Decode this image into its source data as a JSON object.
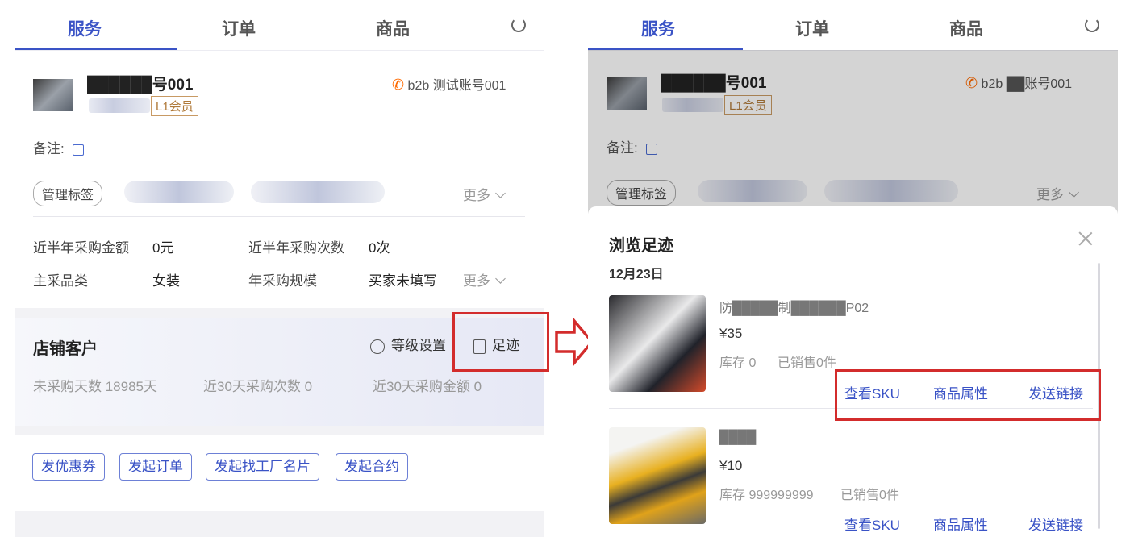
{
  "left": {
    "tabs": [
      "服务",
      "订单",
      "商品"
    ],
    "customer": {
      "name": "██████号001",
      "account": "b2b 测试账号001",
      "level": "L1会员",
      "remark_label": "备注:",
      "tag_button": "管理标签",
      "more": "更多"
    },
    "stats": [
      {
        "label": "近半年采购金额",
        "value": "0元"
      },
      {
        "label": "近半年采购次数",
        "value": "0次"
      },
      {
        "label": "主采品类",
        "value": "女装"
      },
      {
        "label": "年采购规模",
        "value": "买家未填写"
      }
    ],
    "stats_more": "更多",
    "shop": {
      "title": "店铺客户",
      "level_setting": "等级设置",
      "footprint": "足迹",
      "stats": [
        "未采购天数 18985天",
        "近30天采购次数  0",
        "近30天采购金额  0"
      ]
    },
    "actions": [
      "发优惠券",
      "发起订单",
      "发起找工厂名片",
      "发起合约"
    ]
  },
  "right": {
    "tabs": [
      "服务",
      "订单",
      "商品"
    ],
    "customer": {
      "name": "██████号001",
      "account": "b2b ██账号001",
      "level": "L1会员",
      "remark_label": "备注:",
      "tag_button": "管理标签",
      "more": "更多"
    },
    "sheet": {
      "title": "浏览足迹",
      "date": "12月23日",
      "products": [
        {
          "name": "防█████制██████P02",
          "price": "¥35",
          "stock": "库存 0",
          "sold": "已销售0件",
          "links": [
            "查看SKU",
            "商品属性",
            "发送链接"
          ]
        },
        {
          "name": "████",
          "price": "¥10",
          "stock": "库存 999999999",
          "sold": "已销售0件",
          "links": [
            "查看SKU",
            "商品属性",
            "发送链接"
          ]
        }
      ]
    }
  },
  "colors": {
    "accent": "#3a53c6",
    "highlight": "#d32c2c"
  }
}
